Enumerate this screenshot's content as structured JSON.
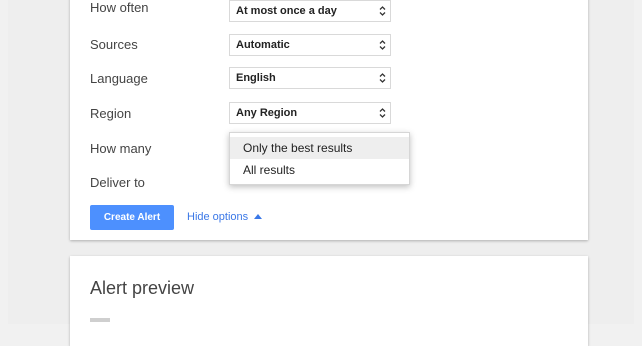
{
  "alert_options": {
    "how_often": {
      "label": "How often",
      "value": "At most once a day"
    },
    "sources": {
      "label": "Sources",
      "value": "Automatic"
    },
    "language": {
      "label": "Language",
      "value": "English"
    },
    "region": {
      "label": "Region",
      "value": "Any Region"
    },
    "how_many": {
      "label": "How many"
    },
    "deliver_to": {
      "label": "Deliver to"
    }
  },
  "how_many_dropdown": {
    "options": [
      "Only the best results",
      "All results"
    ],
    "highlighted": "Only the best results"
  },
  "actions": {
    "create_label": "Create Alert",
    "hide_options_label": "Hide options"
  },
  "preview": {
    "title": "Alert preview"
  },
  "colors": {
    "accent": "#4d90fe",
    "link": "#3b78e7",
    "background": "#eeeeee"
  },
  "icons": {
    "select_arrows": "up-down-chevron-icon",
    "hide_options": "triangle-up-icon"
  }
}
